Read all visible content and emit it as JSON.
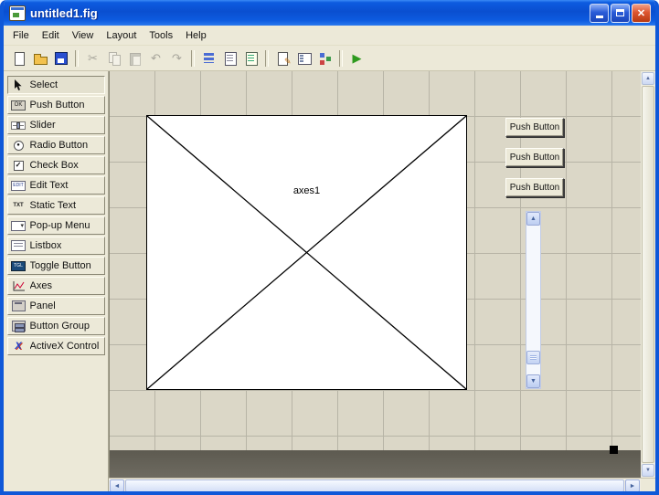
{
  "window": {
    "title": "untitled1.fig"
  },
  "icons": {
    "close": "✕"
  },
  "menu": {
    "items": [
      "File",
      "Edit",
      "View",
      "Layout",
      "Tools",
      "Help"
    ]
  },
  "toolbar": {
    "icons": {
      "cut": "✂",
      "undo": "↶",
      "redo": "↷",
      "pencil": "✎",
      "run": "▶"
    }
  },
  "palette": {
    "items": [
      {
        "label": "Select"
      },
      {
        "label": "Push Button",
        "icon_text": "OK"
      },
      {
        "label": "Slider"
      },
      {
        "label": "Radio Button",
        "icon_text": "●"
      },
      {
        "label": "Check Box",
        "icon_text": "✓"
      },
      {
        "label": "Edit Text",
        "icon_text": "EDIT"
      },
      {
        "label": "Static Text",
        "icon_text": "TXT"
      },
      {
        "label": "Pop-up Menu",
        "icon_text": "▾"
      },
      {
        "label": "Listbox"
      },
      {
        "label": "Toggle Button",
        "icon_text": "TGL"
      },
      {
        "label": "Axes"
      },
      {
        "label": "Panel"
      },
      {
        "label": "Button Group"
      },
      {
        "label": "ActiveX Control",
        "icon_text": "X"
      }
    ]
  },
  "canvas": {
    "axes_label": "axes1",
    "push_buttons": [
      "Push Button",
      "Push Button",
      "Push Button"
    ]
  },
  "scroll": {
    "up": "▲",
    "down": "▼",
    "left": "◄",
    "right": "►"
  },
  "colors": {
    "titlebar_blue": "#0a4fd0",
    "close_red": "#dd5630",
    "face_tan": "#ece9d8",
    "canvas_tan": "#dbd7c7",
    "run_green": "#2e9a1e",
    "slider_blue": "#c3d3f3"
  }
}
